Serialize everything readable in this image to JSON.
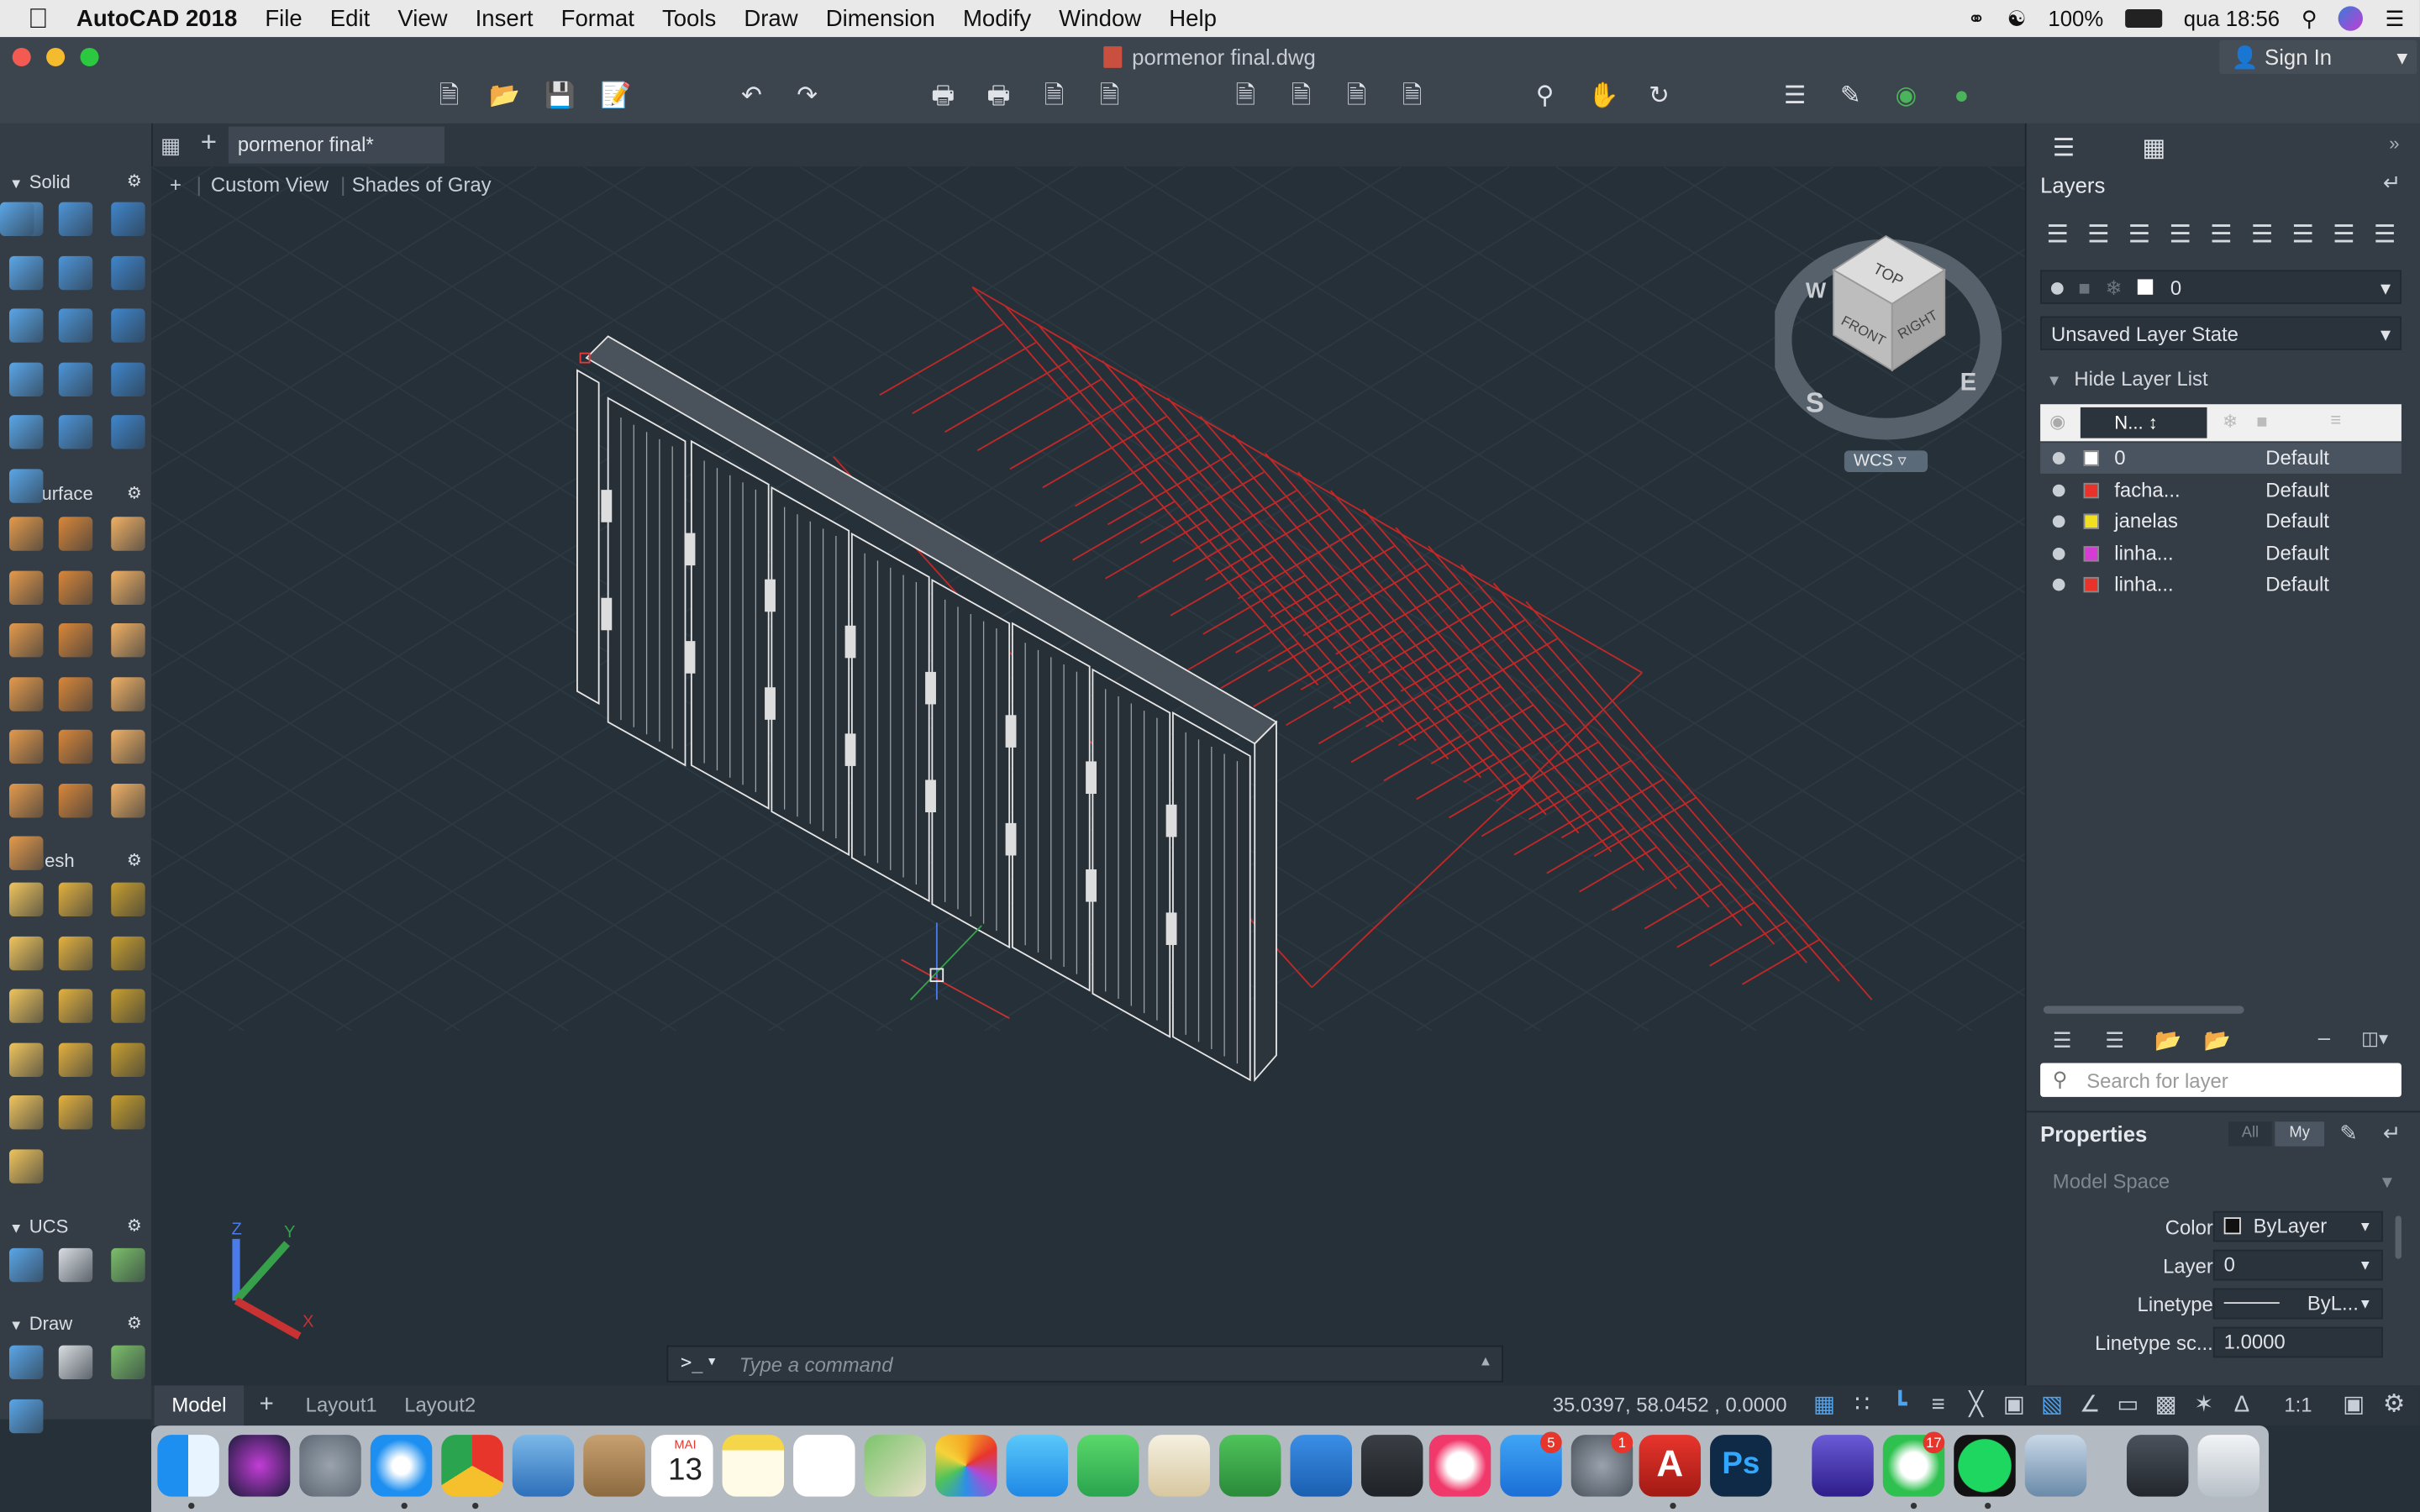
{
  "menubar": {
    "app_name": "AutoCAD 2018",
    "items": [
      "File",
      "Edit",
      "View",
      "Insert",
      "Format",
      "Tools",
      "Draw",
      "Dimension",
      "Modify",
      "Window",
      "Help"
    ],
    "battery": "100%",
    "clock": "qua 18:56"
  },
  "window": {
    "title": "pormenor final.dwg",
    "sign_in": "Sign In"
  },
  "tabs": {
    "doc_tab": "pormenor final*"
  },
  "viewport": {
    "view_name": "Custom View",
    "visual_style": "Shades of Gray",
    "viewcube": {
      "top": "TOP",
      "front": "FRONT",
      "right": "RIGHT",
      "west": "W",
      "south": "S",
      "east": "E",
      "wcs": "WCS"
    },
    "axis_labels": {
      "x": "X",
      "y": "Y",
      "z": "Z"
    }
  },
  "palette": {
    "sections": [
      "Solid",
      "Surface",
      "Mesh",
      "UCS",
      "Draw"
    ]
  },
  "layers": {
    "title": "Layers",
    "current_layer": "0",
    "layer_state": "Unsaved Layer State",
    "hide_list": "Hide Layer List",
    "name_col": "N...",
    "rows": [
      {
        "name": "0",
        "linetype": "Default",
        "color": "#ffffff"
      },
      {
        "name": "facha...",
        "linetype": "Default",
        "color": "#e8322a"
      },
      {
        "name": "janelas",
        "linetype": "Default",
        "color": "#f0e020"
      },
      {
        "name": "linha...",
        "linetype": "Default",
        "color": "#d43cd4"
      },
      {
        "name": "linha...",
        "linetype": "Default",
        "color": "#e8322a"
      }
    ],
    "search_placeholder": "Search for layer"
  },
  "properties": {
    "title": "Properties",
    "filter_all": "All",
    "filter_my": "My",
    "scope": "Model Space",
    "rows": [
      {
        "label": "Color",
        "value": "ByLayer"
      },
      {
        "label": "Layer",
        "value": "0"
      },
      {
        "label": "Linetype",
        "value": "ByL..."
      },
      {
        "label": "Linetype sc...",
        "value": "1.0000"
      }
    ]
  },
  "command": {
    "prompt": ">_",
    "placeholder": "Type a command"
  },
  "status": {
    "tabs": [
      "Model",
      "Layout1",
      "Layout2"
    ],
    "coordinates": "35.0397, 58.0452 , 0.0000",
    "scale": "1:1"
  },
  "dock": {
    "calendar_month": "MAI",
    "calendar_day": "13",
    "appstore_badge": "5",
    "prefs_badge": "1",
    "whatsapp_badge": "17"
  }
}
